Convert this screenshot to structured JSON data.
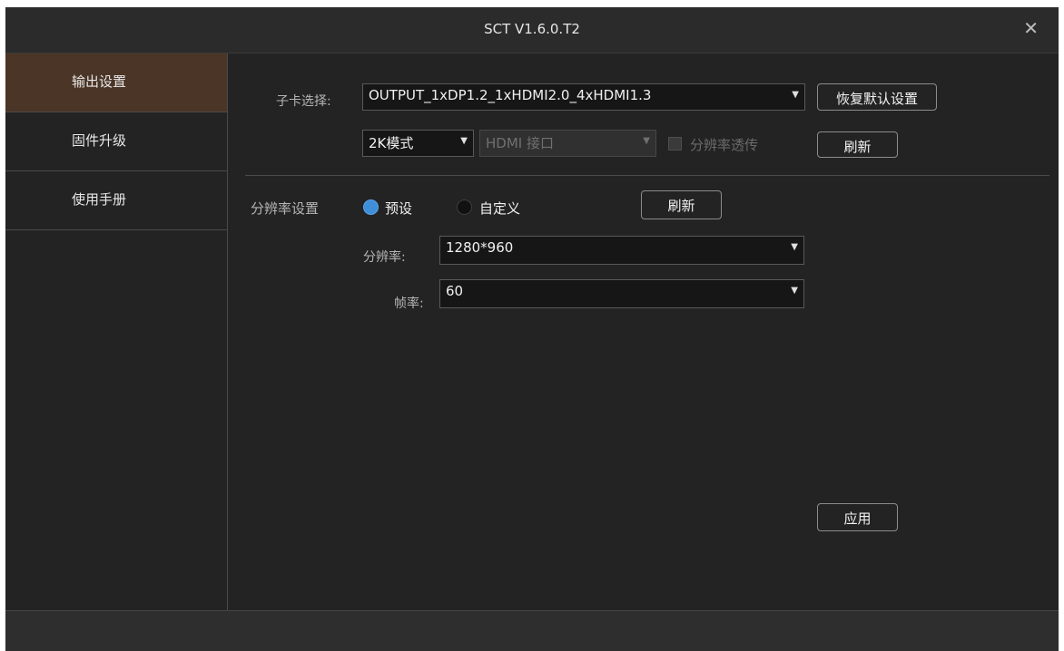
{
  "window": {
    "title": "SCT V1.6.0.T2",
    "close_icon": "close-icon"
  },
  "sidebar": {
    "items": [
      {
        "label": "输出设置",
        "active": true
      },
      {
        "label": "固件升级",
        "active": false
      },
      {
        "label": "使用手册",
        "active": false
      }
    ]
  },
  "subcard": {
    "label": "子卡选择:",
    "selected": "OUTPUT_1xDP1.2_1xHDMI2.0_4xHDMI1.3",
    "restore_label": "恢复默认设置"
  },
  "mode": {
    "selected": "2K模式",
    "interface_selected": "HDMI 接口",
    "interface_disabled": true,
    "passthrough_label": "分辨率透传",
    "passthrough_checked": false,
    "refresh_label": "刷新"
  },
  "resolution": {
    "label": "分辨率设置",
    "preset_label": "预设",
    "custom_label": "自定义",
    "selected_option": "预设",
    "refresh_label": "刷新",
    "res_label": "分辨率:",
    "res_value": "1280*960",
    "rate_label": "帧率:",
    "rate_value": "60"
  },
  "apply_label": "应用",
  "colors": {
    "active_nav": "#4b3526",
    "radio_on": "#3e8ed8",
    "background": "#232323"
  }
}
